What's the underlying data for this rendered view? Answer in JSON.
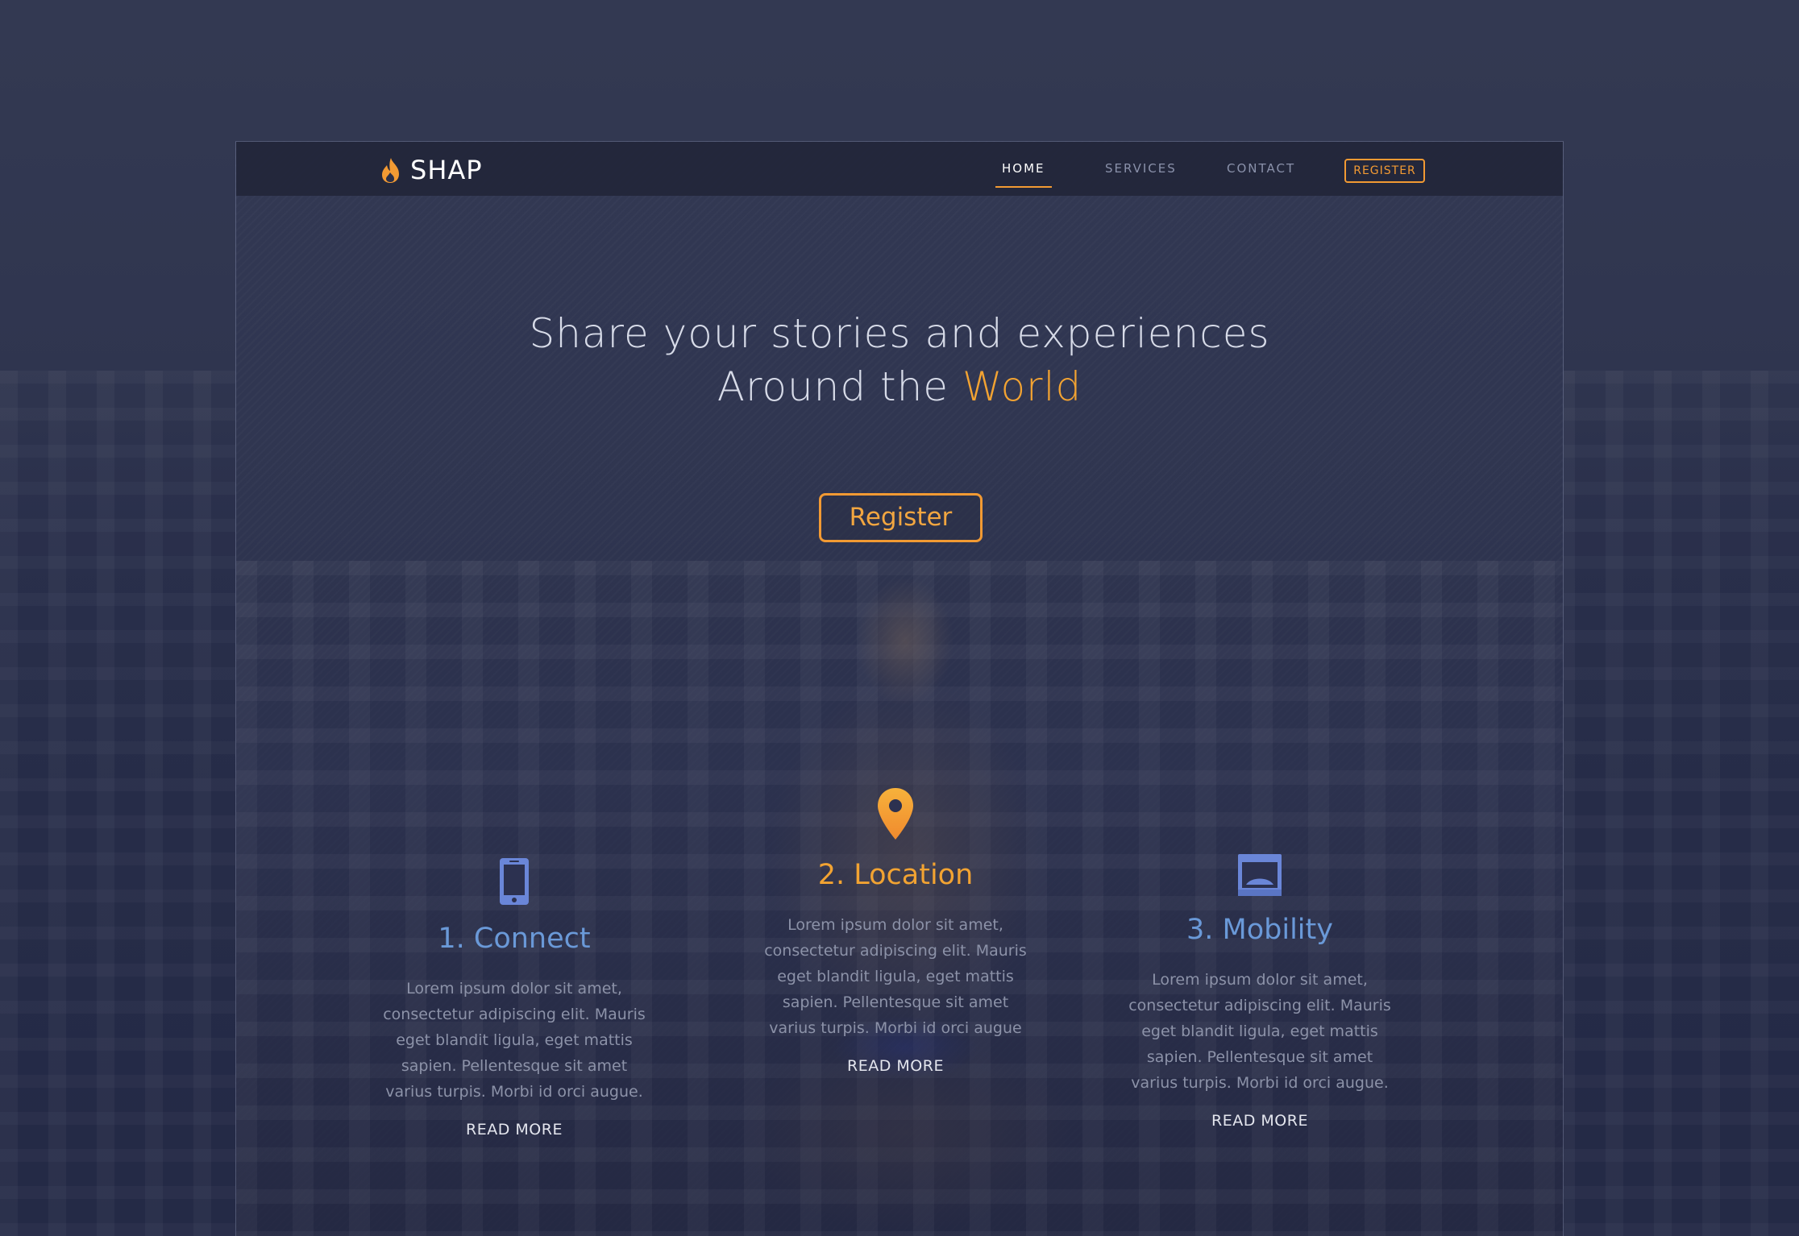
{
  "brand": {
    "name": "SHAP",
    "logo_icon": "flame-icon",
    "accent_color": "#f29a33"
  },
  "nav": {
    "items": [
      {
        "label": "HOME",
        "active": true
      },
      {
        "label": "SERVICES",
        "active": false
      },
      {
        "label": "CONTACT",
        "active": false
      }
    ],
    "register_label": "REGISTER"
  },
  "hero": {
    "line1": "Share your stories and experiences",
    "line2_prefix": "Around the ",
    "line2_accent": "World",
    "register_label": "Register"
  },
  "features": [
    {
      "icon": "smartphone-icon",
      "title": "1. Connect",
      "text": "Lorem ipsum dolor sit amet, consectetur adipiscing elit. Mauris eget blandit ligula, eget mattis sapien. Pellentesque sit amet varius turpis. Morbi id orci augue.",
      "more": "READ MORE"
    },
    {
      "icon": "location-pin-icon",
      "title": "2. Location",
      "text": "Lorem ipsum dolor sit amet, consectetur adipiscing elit. Mauris eget blandit ligula, eget mattis sapien. Pellentesque sit amet varius turpis. Morbi id orci augue",
      "more": "READ MORE"
    },
    {
      "icon": "browser-window-icon",
      "title": "3. Mobility",
      "text": "Lorem ipsum dolor sit amet, consectetur adipiscing elit. Mauris eget blandit ligula, eget mattis sapien. Pellentesque sit amet varius turpis. Morbi id orci augue.",
      "more": "READ MORE"
    }
  ]
}
